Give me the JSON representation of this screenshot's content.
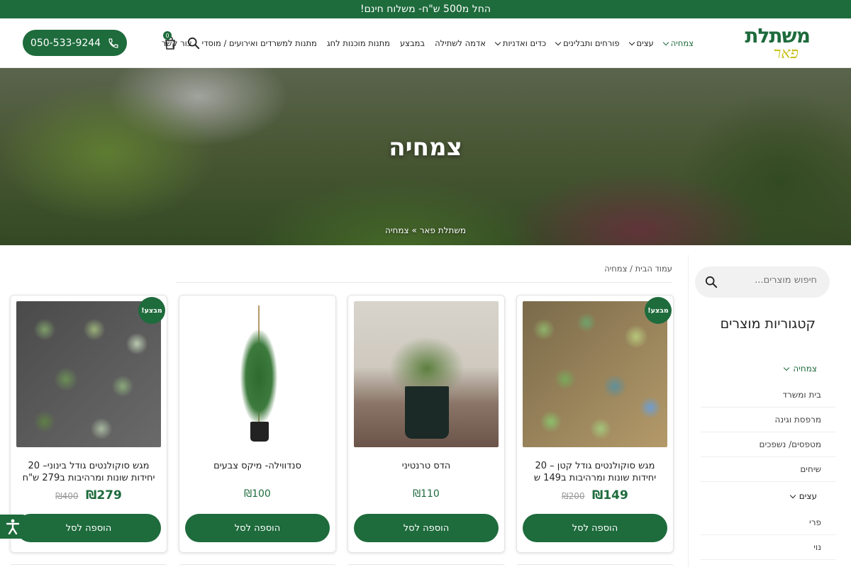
{
  "promo": {
    "text": "החל מ500 ש\"ח- משלוח חינם!"
  },
  "logo": {
    "line1": "משתלת",
    "line2": "פאר"
  },
  "nav": [
    {
      "label": "צמחיה",
      "dropdown": true,
      "active": true
    },
    {
      "label": "עצים",
      "dropdown": true
    },
    {
      "label": "פורחים ותבלינים",
      "dropdown": true
    },
    {
      "label": "כדים ואדניות",
      "dropdown": true
    },
    {
      "label": "אדמה לשתילה",
      "dropdown": false
    },
    {
      "label": "במבצע",
      "dropdown": false
    },
    {
      "label": "מתנות מוכנות לחג",
      "dropdown": false
    },
    {
      "label": "מתנות למשרדים ואירועים / מוסדי",
      "dropdown": false
    },
    {
      "label": "צור קשר",
      "dropdown": false
    }
  ],
  "cart": {
    "count": "0"
  },
  "phone": {
    "number": "050-533-9244"
  },
  "hero": {
    "title": "צמחיה",
    "breadcrumb": "משתלת פאר » צמחיה"
  },
  "breadcrumb": "עמוד הבית / צמחיה",
  "sidebar": {
    "search_placeholder": "חיפוש מוצרים...",
    "title": "קטגוריות מוצרים",
    "categories": [
      {
        "label": "צמחיה",
        "type": "parent-active"
      },
      {
        "label": "בית ומשרד",
        "type": "child"
      },
      {
        "label": "מרפסת וגינה",
        "type": "child"
      },
      {
        "label": "מטפסים/ נשפכים",
        "type": "child"
      },
      {
        "label": "שיחים",
        "type": "child"
      },
      {
        "label": "עצים",
        "type": "parent"
      },
      {
        "label": "פרי",
        "type": "child"
      },
      {
        "label": "נוי",
        "type": "child"
      }
    ]
  },
  "products": [
    {
      "name": "מגש סוקולנטים גודל קטן – 20 יחידות שונות ומרהיבות ב149 ש",
      "price": "₪149",
      "old_price": "₪200",
      "on_sale": true,
      "badge": "מבצע!",
      "button": "הוספה לסל",
      "image": "succulent-tray-small"
    },
    {
      "name": "הדס טרנטיני",
      "price": "₪110",
      "old_price": "",
      "on_sale": false,
      "badge": "",
      "button": "הוספה לסל",
      "image": "myrtle-plant"
    },
    {
      "name": "סנדווילה- מיקס צבעים",
      "price": "₪100",
      "old_price": "",
      "on_sale": false,
      "badge": "",
      "button": "הוספה לסל",
      "image": "mandevilla-plant"
    },
    {
      "name": "מגש סוקולנטים גודל בינוני– 20 יחידות שונות ומרהיבות ב279 ש\"ח",
      "price": "₪279",
      "old_price": "₪400",
      "on_sale": true,
      "badge": "מבצע!",
      "button": "הוספה לסל",
      "image": "succulent-tray-medium"
    }
  ],
  "colors": {
    "brand_green": "#1e6b3c",
    "logo_yellow": "#c9c01a"
  }
}
